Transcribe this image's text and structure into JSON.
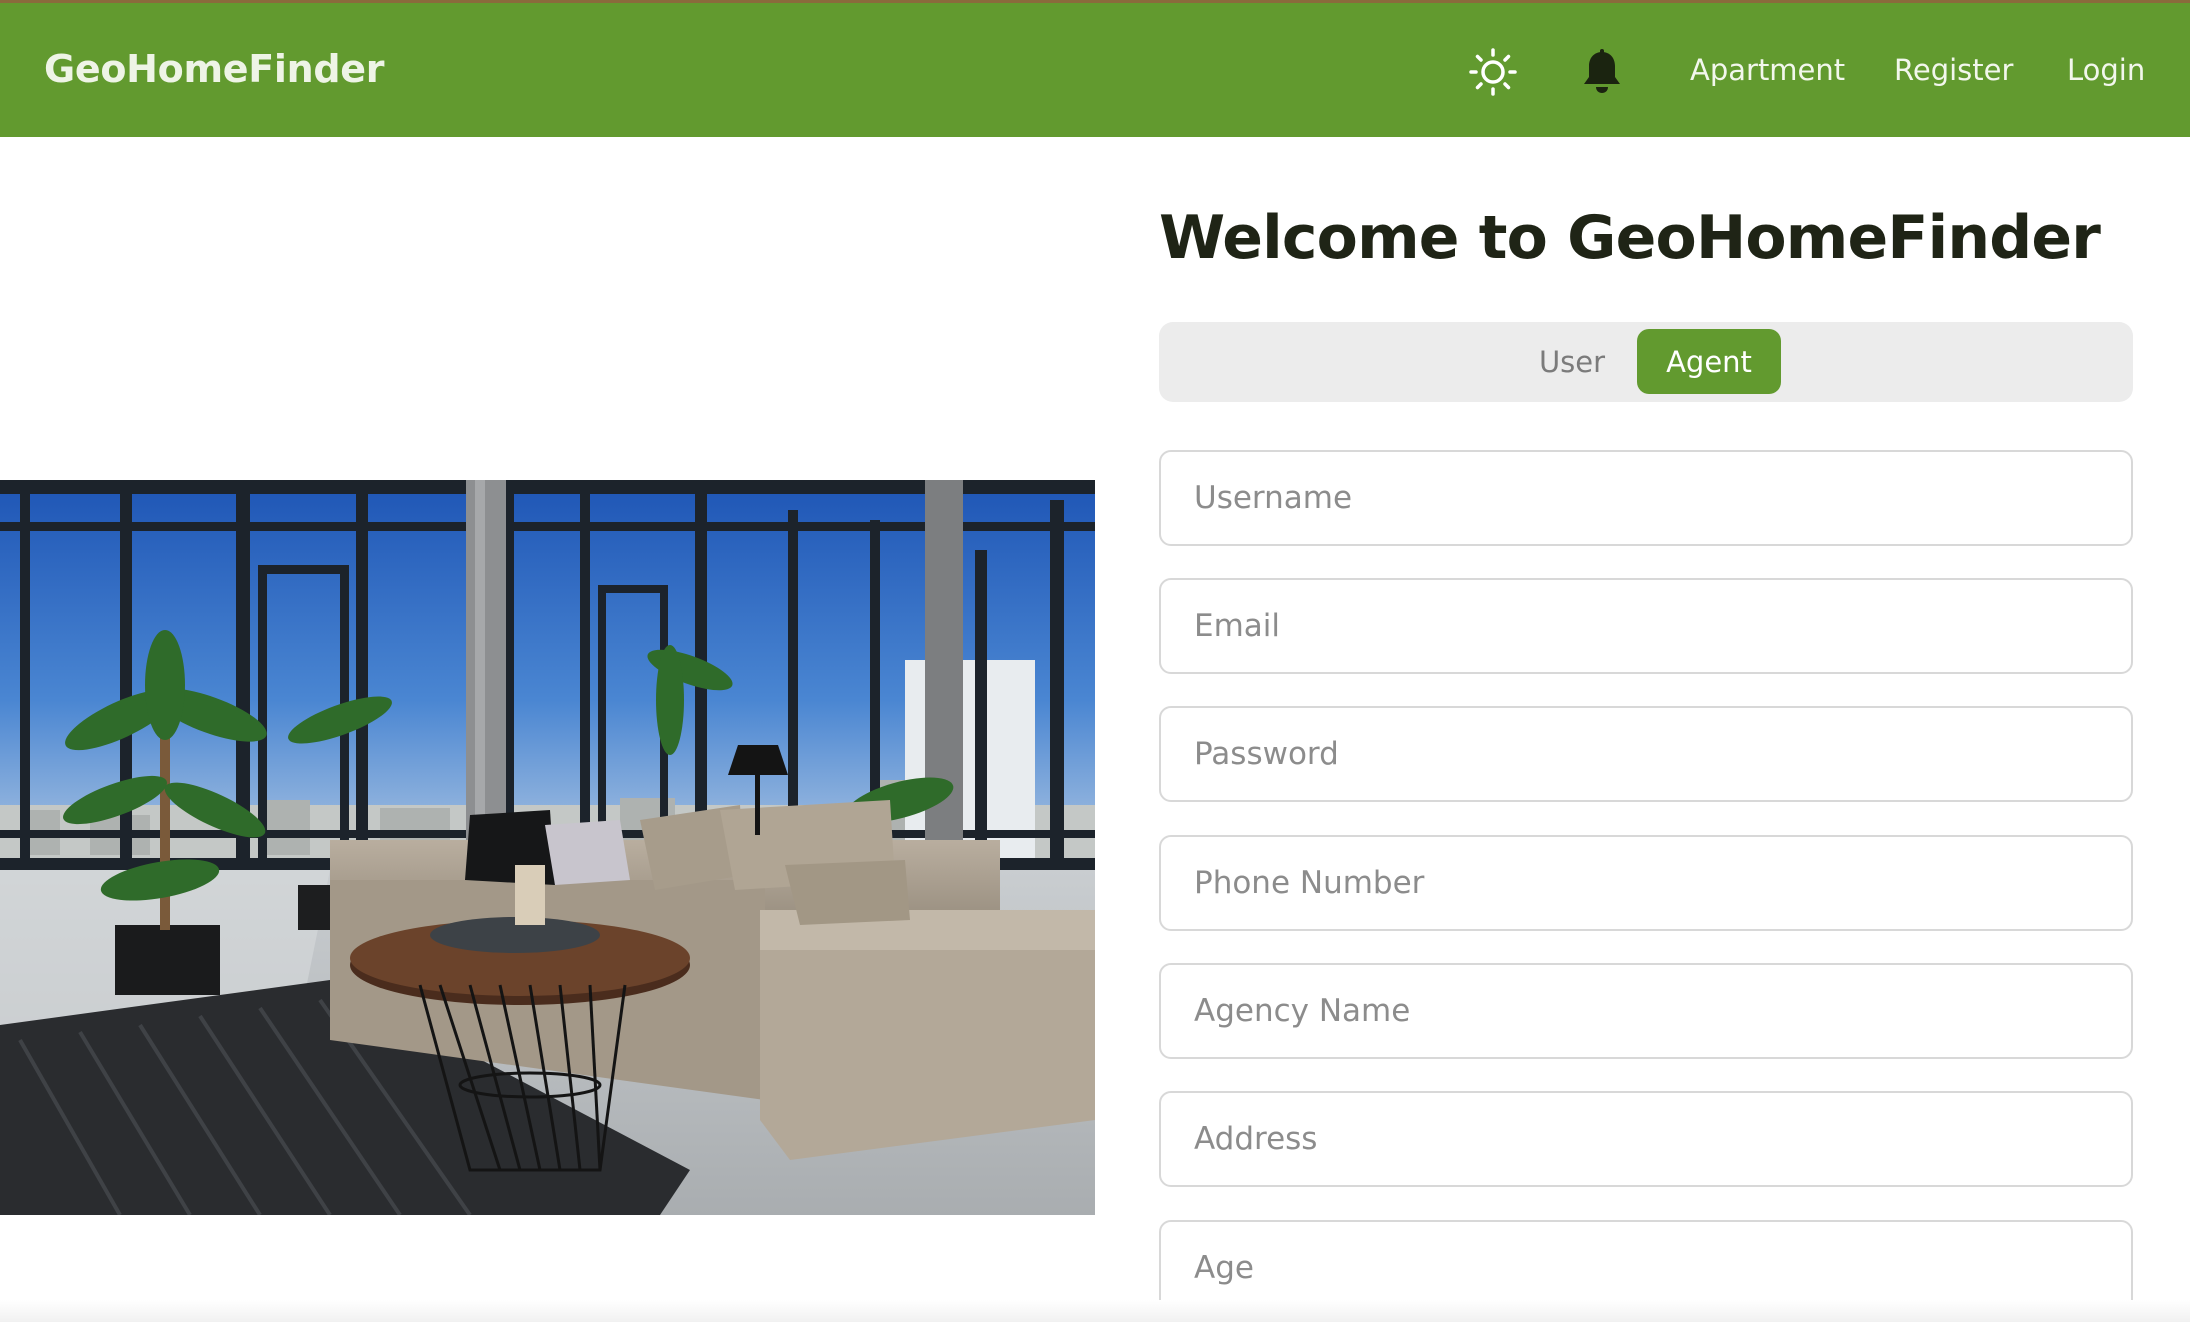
{
  "app": {
    "brand": "GeoHomeFinder"
  },
  "navbar": {
    "theme_icon": "sun-icon",
    "notification_icon": "bell-icon",
    "links": [
      "Apartment",
      "Register",
      "Login"
    ]
  },
  "hero_image": {
    "subject": "sunlit-apartment-living-room-photo"
  },
  "form": {
    "title": "Welcome to GeoHomeFinder",
    "role_toggle": {
      "options": [
        "User",
        "Agent"
      ],
      "selected": "Agent"
    },
    "fields": {
      "username": {
        "placeholder": "Username",
        "value": ""
      },
      "email": {
        "placeholder": "Email",
        "value": ""
      },
      "password": {
        "placeholder": "Password",
        "value": ""
      },
      "phone": {
        "placeholder": "Phone Number",
        "value": ""
      },
      "agency": {
        "placeholder": "Agency Name",
        "value": ""
      },
      "address": {
        "placeholder": "Address",
        "value": ""
      },
      "age": {
        "placeholder": "Age",
        "value": ""
      }
    }
  },
  "colors": {
    "brand_green": "#629a2f",
    "text_dark": "#1f2416",
    "toggle_bg": "#ececec",
    "field_border": "#d8d8d8"
  }
}
